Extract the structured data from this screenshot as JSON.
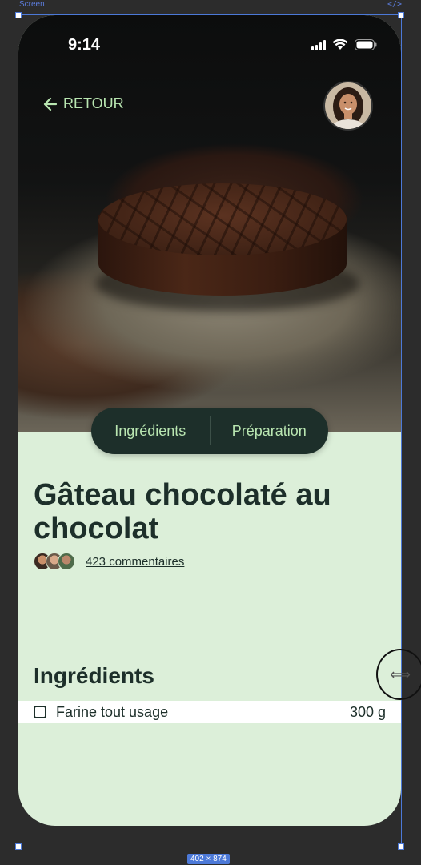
{
  "canvas": {
    "frame_label": "Screen",
    "code_icon": "</>",
    "size_badge": "402 × 874"
  },
  "status_bar": {
    "time": "9:14",
    "icons": [
      "cellular-signal-icon",
      "wifi-icon",
      "battery-icon"
    ]
  },
  "nav": {
    "back_label": "RETOUR",
    "back_icon": "arrow-left-icon",
    "avatar": "user-avatar"
  },
  "tabs": [
    {
      "label": "Ingrédients"
    },
    {
      "label": "Préparation"
    }
  ],
  "recipe": {
    "title": "Gâteau chocolaté au chocolat",
    "comments_label": "423 commentaires"
  },
  "ingredients": {
    "heading": "Ingrédients",
    "items": [
      {
        "name": "Farine tout usage",
        "quantity": "300 g",
        "checked": false
      }
    ]
  },
  "colors": {
    "accent_green": "#b9e6b1",
    "dark_green": "#1d2f2a",
    "background_mint": "#dcefd9"
  }
}
